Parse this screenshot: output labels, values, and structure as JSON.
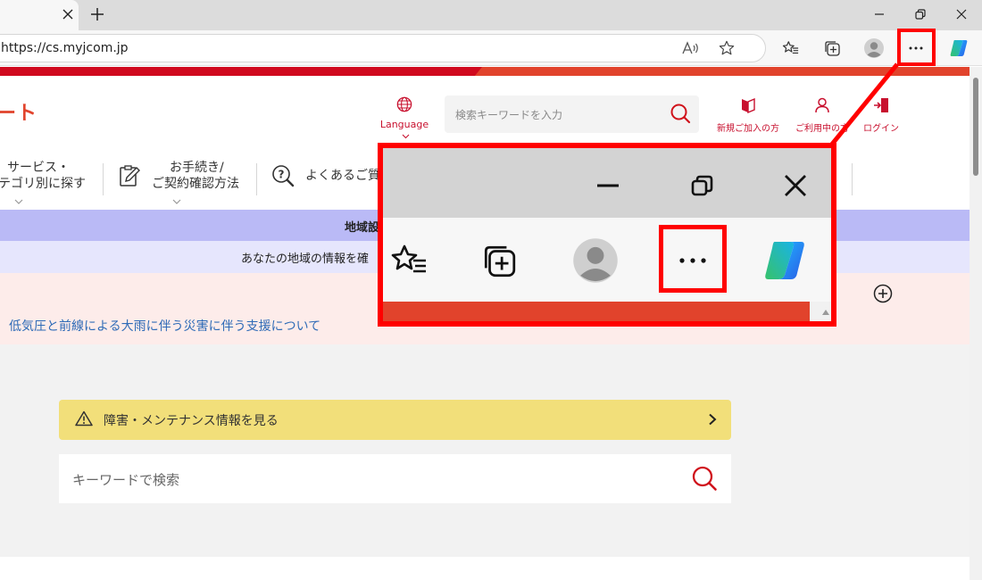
{
  "browser": {
    "url": "https://cs.myjcom.jp",
    "new_tab_symbol": "+",
    "tab_close_symbol": "×",
    "more_symbol": "···"
  },
  "header": {
    "logo_partial": "ート",
    "language_label": "Language",
    "search_placeholder": "検索キーワードを入力",
    "links": [
      {
        "label": "新規ご加入の方"
      },
      {
        "label": "ご利用中の方"
      },
      {
        "label": "ログイン"
      }
    ]
  },
  "nav": {
    "items": [
      {
        "line1": "サービス・",
        "line2": "テゴリ別に探す"
      },
      {
        "line1": "お手続き/",
        "line2": "ご契約確認方法"
      },
      {
        "line1": "よくあるご質",
        "line2": ""
      }
    ]
  },
  "region": {
    "title": "地域設",
    "subtitle": "あなたの地域の情報を確"
  },
  "notice": {
    "link_text": "低気圧と前線による大雨に伴う災害に伴う支援について"
  },
  "maintenance": {
    "label": "障害・メンテナンス情報を見る"
  },
  "keyword_search": {
    "placeholder": "キーワードで検索"
  },
  "colors": {
    "brand_red": "#e1432c",
    "highlight_red": "#ff0000",
    "region_bar": "#babaf6",
    "maintenance_yellow": "#f2df7a",
    "link_blue": "#2e6bb7"
  }
}
